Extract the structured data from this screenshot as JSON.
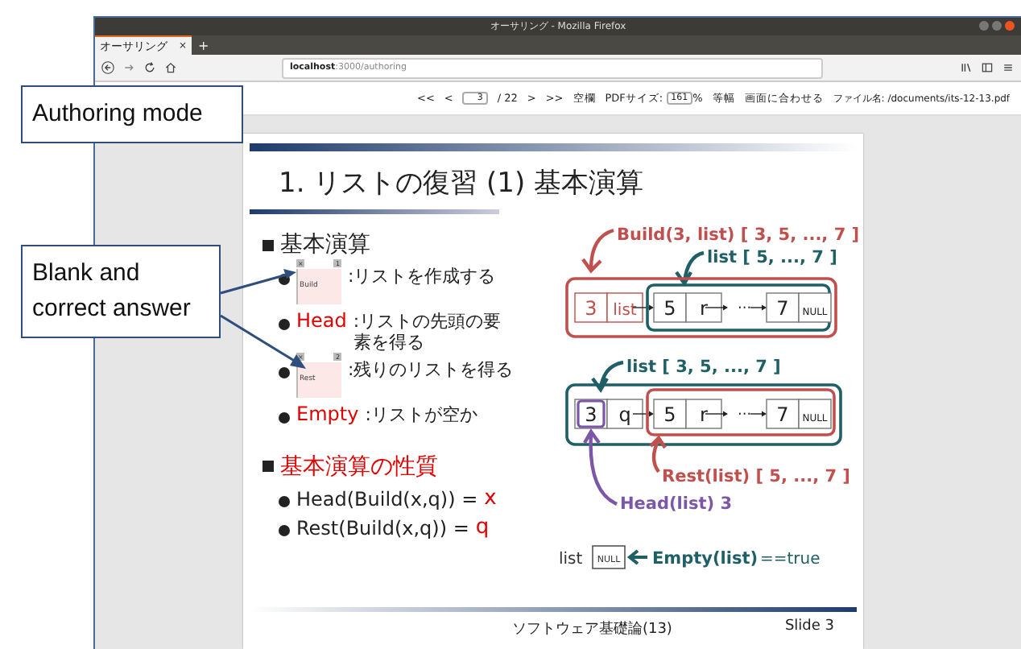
{
  "window": {
    "title": "オーサリング - Mozilla Firefox"
  },
  "tabs": [
    {
      "label": "オーサリング",
      "close": "×",
      "selected": true
    }
  ],
  "new_tab": "+",
  "address_bar": {
    "host": "localhost",
    "path": ":3000/authoring"
  },
  "viewer_toolbar": {
    "first": "<<",
    "prev": "<",
    "page": "3",
    "total": "/ 22",
    "next": ">",
    "last": ">>",
    "blank_button": "空欄",
    "size_label": "PDFサイズ:",
    "size": "161",
    "size_unit": "%",
    "fit_width": "等幅",
    "fit_screen": "画面に合わせる",
    "file_name": "ファイル名: /documents/its-12-13.pdf"
  },
  "slide": {
    "title": "1. リストの復習 (1) 基本演算",
    "sections": [
      {
        "heading": "基本演算",
        "emphasis": false,
        "items": [
          {
            "kind": "blank",
            "answer": "Build",
            "tags": [
              "×",
              "1"
            ],
            "description": ":リストを作成する"
          },
          {
            "kind": "term",
            "term": "Head",
            "description": ":リストの先頭の要素を得る"
          },
          {
            "kind": "blank",
            "answer": "Rest",
            "tags": [
              "×",
              "2"
            ],
            "description": ":残りのリストを得る"
          },
          {
            "kind": "term",
            "term": "Empty",
            "description": ":リストが空か"
          }
        ]
      },
      {
        "heading": "基本演算の性質",
        "emphasis": true,
        "items": [
          {
            "kind": "equation",
            "expression": "Head(Build(x,q)) = ",
            "result": "x"
          },
          {
            "kind": "equation",
            "expression": "Rest(Build(x,q)) = ",
            "result": "q"
          }
        ]
      }
    ],
    "diagram": {
      "build": {
        "label": "Build(3, list) [ 3, 5, ..., 7 ]",
        "sublabel": "list [ 5, ..., 7 ]",
        "new_cells": [
          "3",
          "list"
        ],
        "cells": [
          "5",
          "r",
          "···",
          "7",
          "NULL"
        ]
      },
      "split": {
        "label": "list [ 3, 5, ..., 7 ]",
        "first_cells": [
          "3",
          "q"
        ],
        "cells": [
          "5",
          "r",
          "···",
          "7",
          "NULL"
        ],
        "rest_label": "Rest(list) [ 5, ..., 7 ]",
        "head_label": "Head(list) 3"
      },
      "empty": {
        "list": "list",
        "null": "NULL",
        "label": "Empty(list)",
        "result": "==true"
      }
    },
    "footer": {
      "course": "ソフトウェア基礎論(13)",
      "slide_number": "Slide 3"
    }
  },
  "callouts": [
    {
      "kind": "mode",
      "text": "Authoring mode"
    },
    {
      "kind": "blank",
      "text": "Blank and correct answer"
    }
  ]
}
